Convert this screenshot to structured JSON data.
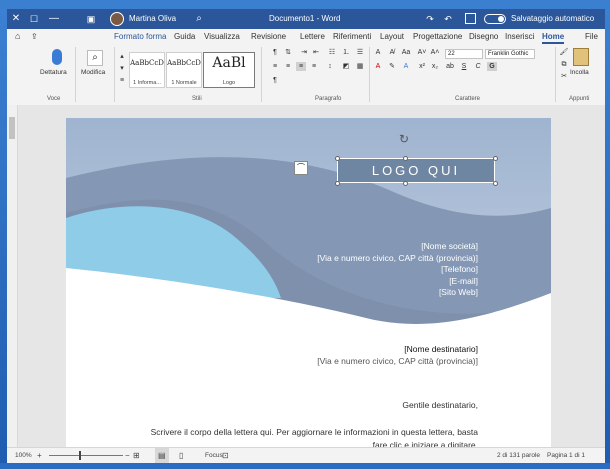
{
  "titlebar": {
    "close_glyph": "✕",
    "minimize_glyph": "—",
    "maximize_glyph": "☐",
    "user_name": "Martina Oliva",
    "document_title": "Documento1 - Word",
    "autosave_label": "Salvataggio automatico"
  },
  "tabs": [
    {
      "label": "File"
    },
    {
      "label": "Home"
    },
    {
      "label": "Inserisci"
    },
    {
      "label": "Disegno"
    },
    {
      "label": "Progettazione"
    },
    {
      "label": "Layout"
    },
    {
      "label": "Riferimenti"
    },
    {
      "label": "Lettere"
    },
    {
      "label": "Revisione"
    },
    {
      "label": "Visualizza"
    },
    {
      "label": "Guida"
    },
    {
      "label": "Formato forma"
    }
  ],
  "ribbon": {
    "clipboard": {
      "paste_label": "Incolla",
      "group": "Appunti"
    },
    "font": {
      "name": "Franklin Gothic",
      "size": "22",
      "group": "Carattere"
    },
    "paragraph": {
      "group": "Paragrafo"
    },
    "styles": {
      "group": "Stili",
      "items": [
        {
          "sample": "AaBl",
          "label": "Logo"
        },
        {
          "sample": "AaBbCcD",
          "label": "1 Normale"
        },
        {
          "sample": "AaBbCcD",
          "label": "1 Informa..."
        }
      ]
    },
    "editing": {
      "label": "Modifica"
    },
    "voice": {
      "dictate_label": "Dettatura",
      "group": "Voce"
    }
  },
  "document": {
    "logo_text": "LOGO QUI",
    "company_lines": [
      "[Nome società]",
      "[Via e numero civico, CAP città (provincia)]",
      "[Telefono]",
      "[E-mail]",
      "[Sito Web]"
    ],
    "recipient_name": "[Nome destinatario]",
    "recipient_address": "[Via e numero civico, CAP città (provincia)]",
    "greeting": "Gentile destinatario,",
    "body_line1": "Scrivere il corpo della lettera qui. Per aggiornare le informazioni in questa lettera, basta",
    "body_line2": "fare clic e iniziare a digitare."
  },
  "statusbar": {
    "page": "Pagina 1 di 1",
    "words": "2 di 131 parole",
    "focus": "Focus",
    "zoom": "100%"
  },
  "colors": {
    "title_bar": "#2b579a",
    "wave_dark": "#7f90ad",
    "wave_light": "#8ecce8",
    "logo_fill": "#6f86a3"
  }
}
